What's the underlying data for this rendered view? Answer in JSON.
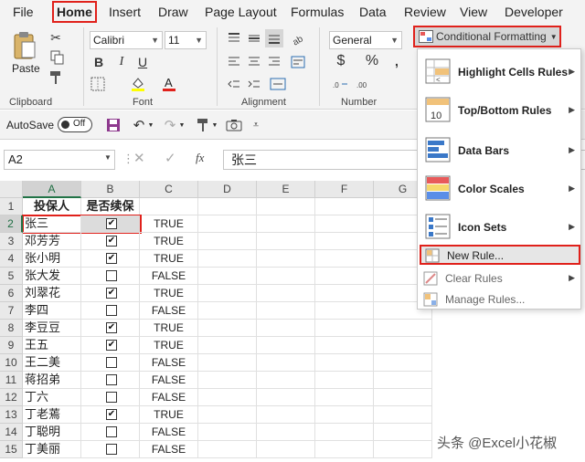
{
  "menu": {
    "tabs": [
      "File",
      "Home",
      "Insert",
      "Draw",
      "Page Layout",
      "Formulas",
      "Data",
      "Review",
      "View",
      "Developer"
    ],
    "active": "Home"
  },
  "ribbon": {
    "paste_label": "Paste",
    "font_name": "Calibri",
    "font_size": "11",
    "number_format": "General",
    "bold": "B",
    "italic": "I",
    "underline": "U",
    "currency": "$",
    "percent": "%",
    "groups": {
      "clipboard": "Clipboard",
      "font": "Font",
      "alignment": "Alignment",
      "number": "Number"
    },
    "cf_button": "Conditional Formatting"
  },
  "qat": {
    "autosave_label": "AutoSave",
    "autosave_state": "Off"
  },
  "formula_bar": {
    "name_box": "A2",
    "fx": "fx",
    "content": "张三"
  },
  "grid": {
    "columns": [
      "A",
      "B",
      "C",
      "D",
      "E",
      "F",
      "G"
    ],
    "header_row": {
      "a": "投保人",
      "b": "是否续保"
    },
    "rows": [
      {
        "n": "2",
        "name": "张三",
        "checked": true,
        "value": "TRUE"
      },
      {
        "n": "3",
        "name": "邓芳芳",
        "checked": true,
        "value": "TRUE"
      },
      {
        "n": "4",
        "name": "张小明",
        "checked": true,
        "value": "TRUE"
      },
      {
        "n": "5",
        "name": "张大发",
        "checked": false,
        "value": "FALSE"
      },
      {
        "n": "6",
        "name": "刘翠花",
        "checked": true,
        "value": "TRUE"
      },
      {
        "n": "7",
        "name": "李四",
        "checked": false,
        "value": "FALSE"
      },
      {
        "n": "8",
        "name": "李豆豆",
        "checked": true,
        "value": "TRUE"
      },
      {
        "n": "9",
        "name": "王五",
        "checked": true,
        "value": "TRUE"
      },
      {
        "n": "10",
        "name": "王二美",
        "checked": false,
        "value": "FALSE"
      },
      {
        "n": "11",
        "name": "蒋招弟",
        "checked": false,
        "value": "FALSE"
      },
      {
        "n": "12",
        "name": "丁六",
        "checked": false,
        "value": "FALSE"
      },
      {
        "n": "13",
        "name": "丁老蔫",
        "checked": true,
        "value": "TRUE"
      },
      {
        "n": "14",
        "name": "丁聪明",
        "checked": false,
        "value": "FALSE"
      },
      {
        "n": "15",
        "name": "丁美丽",
        "checked": false,
        "value": "FALSE"
      }
    ]
  },
  "cf_menu": {
    "items": [
      {
        "label": "Highlight Cells Rules",
        "submenu": true
      },
      {
        "label": "Top/Bottom Rules",
        "submenu": true
      },
      {
        "label": "Data Bars",
        "submenu": true
      },
      {
        "label": "Color Scales",
        "submenu": true
      },
      {
        "label": "Icon Sets",
        "submenu": true
      },
      {
        "label": "New Rule...",
        "submenu": false
      },
      {
        "label": "Clear Rules",
        "submenu": true
      },
      {
        "label": "Manage Rules...",
        "submenu": false
      }
    ]
  },
  "watermark": "头条 @Excel小花椒",
  "colors": {
    "highlight_box": "#e0211b",
    "excel_green": "#217346",
    "ribbon_bg": "#f3f3f3"
  }
}
